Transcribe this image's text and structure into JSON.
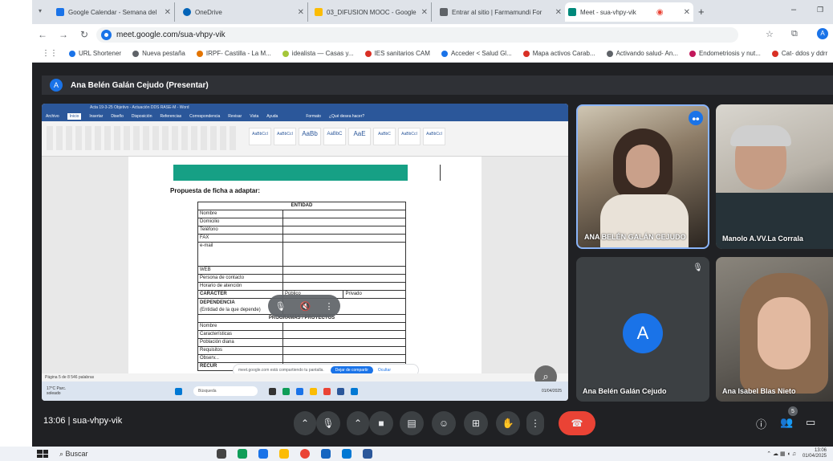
{
  "browser": {
    "tabs": [
      {
        "label": "Google Calendar - Semana del",
        "color": "#1a73e8"
      },
      {
        "label": "OneDrive",
        "color": "#0364b8"
      },
      {
        "label": "03_DIFUSION MOOC - Google",
        "color": "#fbbc04"
      },
      {
        "label": "Entrar al sitio | Farmamundi For",
        "color": "#5f6368"
      },
      {
        "label": "Meet - sua-vhpy-vik",
        "color": "#00897b"
      }
    ],
    "url": "meet.google.com/sua-vhpy-vik",
    "bookmarks": [
      {
        "label": "URL Shortener",
        "color": "#1a73e8"
      },
      {
        "label": "Nueva pestaña",
        "color": "#5f6368"
      },
      {
        "label": "IRPF- Castilla - La M...",
        "color": "#e37400"
      },
      {
        "label": "idealista — Casas y...",
        "color": "#a4c639"
      },
      {
        "label": "IES sanitarios CAM",
        "color": "#d93025"
      },
      {
        "label": "Acceder < Salud Gl...",
        "color": "#1a73e8"
      },
      {
        "label": "Mapa activos Carab...",
        "color": "#d93025"
      },
      {
        "label": "Activando salud- An...",
        "color": "#5f6368"
      },
      {
        "label": "Endometriosis y nut...",
        "color": "#c2185b"
      },
      {
        "label": "Cat- ddos y ddrr",
        "color": "#d93025"
      }
    ]
  },
  "presenter": {
    "avatar": "A",
    "name": "Ana Belén Galán Cejudo (Presentar)"
  },
  "word": {
    "title": "Acta 19-3-25 Objetivo - Actuación DDS RASE-M - Word",
    "tabs": [
      "Archivo",
      "Inicio",
      "Insertar",
      "Diseño",
      "Disposición",
      "Referencias",
      "Correspondencia",
      "Revisar",
      "Vista",
      "Ayuda",
      "Formato",
      "¿Qué desea hacer?"
    ],
    "styles": [
      "AaBbCcI",
      "AaBbCcI",
      "AaBb",
      "AaBbC",
      "AaE",
      "AaBbC",
      "AaBbCcI",
      "AaBbCcI"
    ],
    "heading": "Propuesta de ficha a adaptar:",
    "table": {
      "entidad": "ENTIDAD",
      "rows1": [
        "Nombre",
        "Domicilio",
        "Teléfono",
        "FAX",
        "e-mail",
        "",
        "",
        "",
        "WEB",
        "Persona de contacto",
        "Horario de atención"
      ],
      "caracter": "CARÁCTER",
      "publico": "Público",
      "privado": "Privado",
      "dependencia": "DEPENDENCIA",
      "dependencia_sub": "(Entidad de la que depende)",
      "programas": "PROGRAMAS / PROYECTOS",
      "rows2": [
        "Nombre",
        "Características",
        "Población diana",
        "Requisitos",
        "Observ..."
      ],
      "recur": "RECUR"
    },
    "status": "Página 5 de 8   546 palabras",
    "share_text": "meet.google.com está compartiendo tu pantalla.",
    "share_stop": "Dejar de compartir",
    "share_hide": "Ocultar",
    "taskbar_search": "Búsqueda",
    "taskbar_weather": "17°C Parc. soleado",
    "taskbar_date": "01/04/2025"
  },
  "participants": [
    {
      "name": "ANA BELÉN GALÁN CEJUDO",
      "type": "video"
    },
    {
      "name": "Manolo A.VV.La Corrala",
      "type": "video"
    },
    {
      "name": "Ana Belén Galán Cejudo",
      "type": "avatar",
      "initial": "A"
    },
    {
      "name": "Ana Isabel Blas Nieto",
      "type": "video"
    }
  ],
  "meet": {
    "time_code": "13:06 | sua-vhpy-vik",
    "people_count": "5"
  },
  "taskbar": {
    "search": "Buscar",
    "time": "13:06",
    "date": "01/04/2025"
  }
}
